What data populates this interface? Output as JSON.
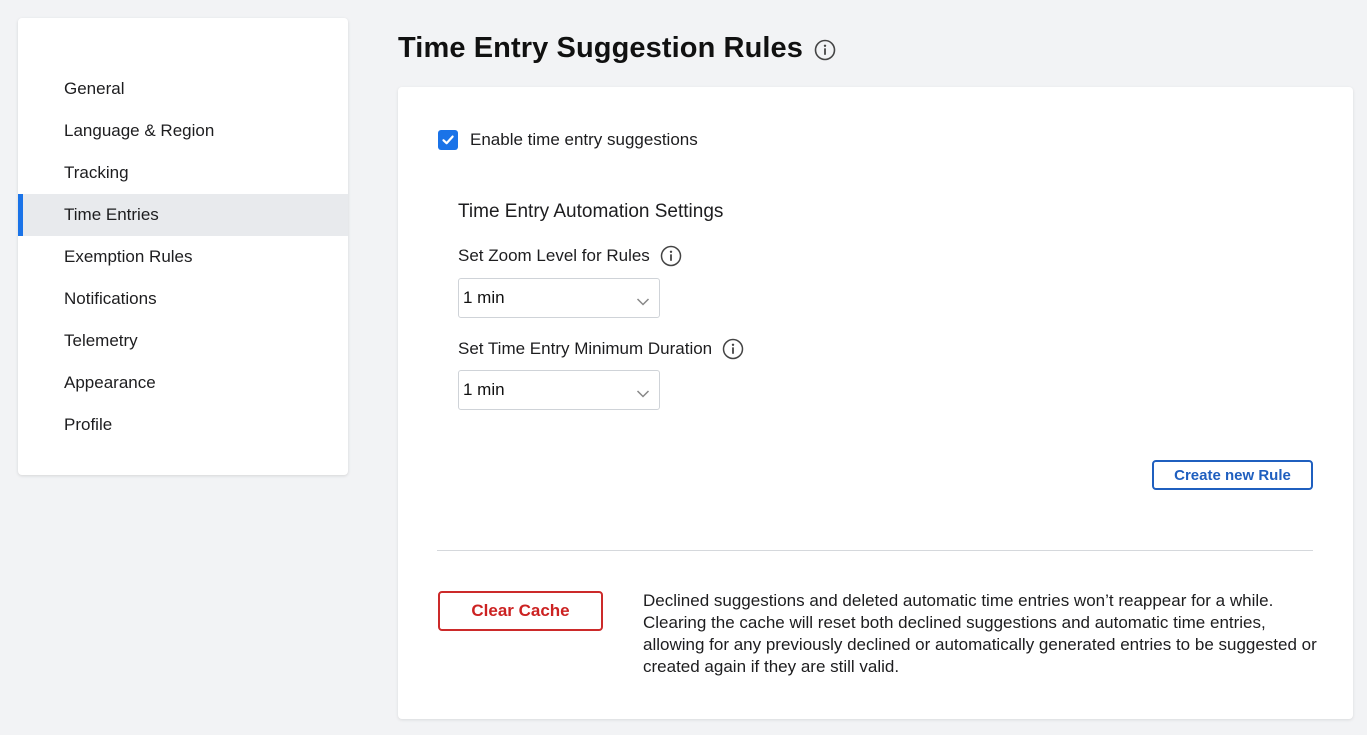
{
  "sidebar": {
    "items": [
      {
        "label": "General",
        "active": false
      },
      {
        "label": "Language & Region",
        "active": false
      },
      {
        "label": "Tracking",
        "active": false
      },
      {
        "label": "Time Entries",
        "active": true
      },
      {
        "label": "Exemption Rules",
        "active": false
      },
      {
        "label": "Notifications",
        "active": false
      },
      {
        "label": "Telemetry",
        "active": false
      },
      {
        "label": "Appearance",
        "active": false
      },
      {
        "label": "Profile",
        "active": false
      }
    ]
  },
  "page": {
    "title": "Time Entry Suggestion Rules",
    "title_icon": "info-icon"
  },
  "settings": {
    "enable_label": "Enable time entry suggestions",
    "enable_checked": true,
    "section_title": "Time Entry Automation Settings",
    "zoom_label": "Set Zoom Level for Rules",
    "zoom_value": "1 min",
    "min_duration_label": "Set Time Entry Minimum Duration",
    "min_duration_value": "1 min",
    "create_rule_label": "Create new Rule"
  },
  "cache": {
    "button_label": "Clear Cache",
    "description": "Declined suggestions and deleted automatic time entries won’t reappear for a while. Clearing the cache will reset both declined suggestions and automatic time entries, allowing for any previously declined or automatically generated entries to be suggested or created again if they are still valid."
  },
  "colors": {
    "accent": "#1a73e8",
    "active_bg": "#e8eaed",
    "danger": "#cc2222",
    "page_bg": "#f2f3f5"
  }
}
